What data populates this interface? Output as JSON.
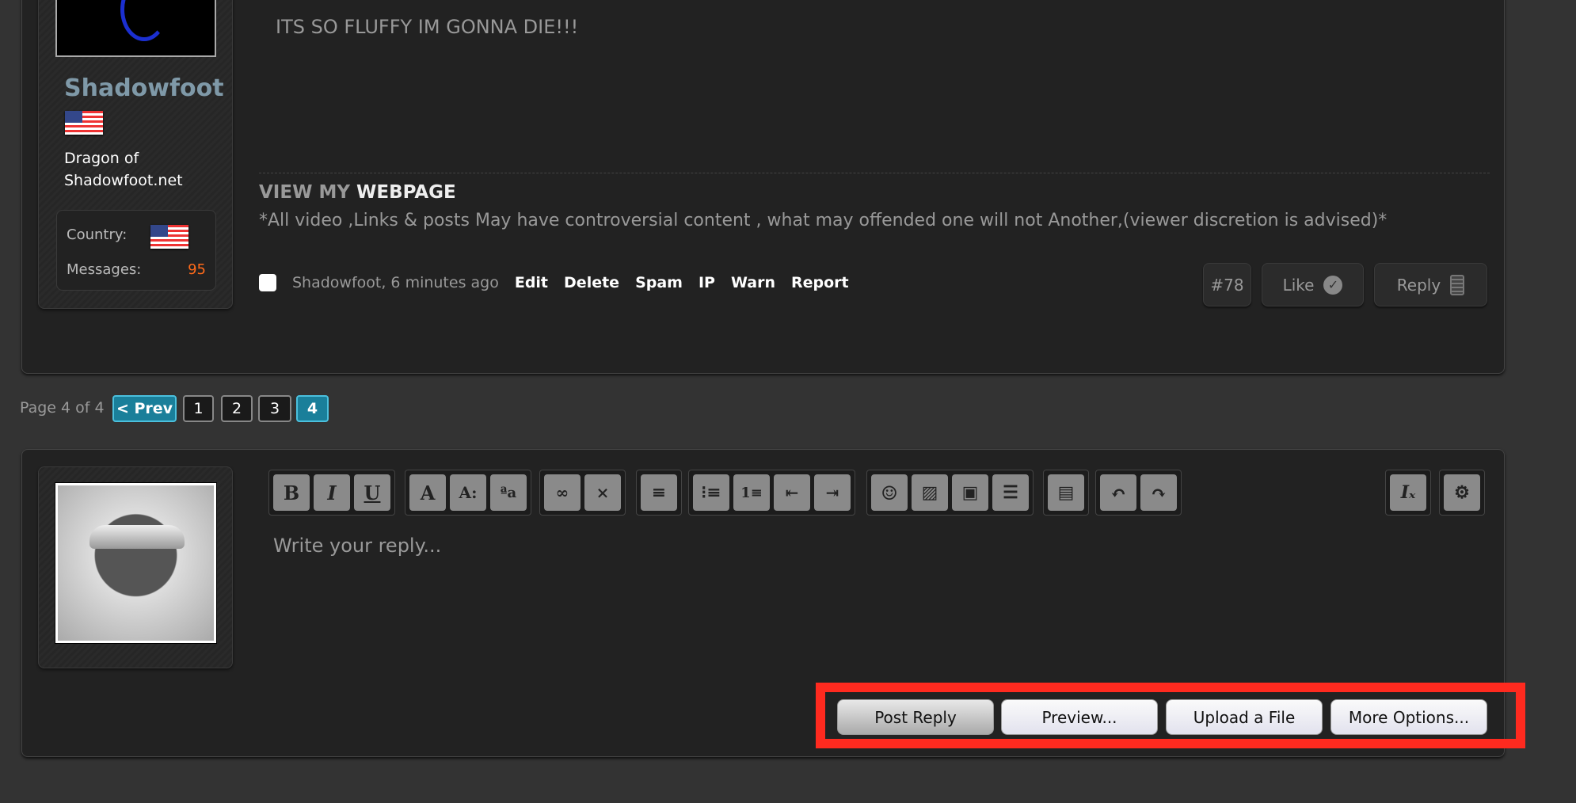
{
  "post": {
    "username": "Shadowfoot",
    "user_title": [
      "Dragon of",
      "Shadowfoot.net"
    ],
    "stats": {
      "country_label": "Country:",
      "messages_label": "Messages:",
      "messages": "95"
    },
    "message": "ITS SO FLUFFY IM GONNA DIE!!!",
    "signature": {
      "view_my": "VIEW MY",
      "webpage": "WEBPAGE",
      "disclaimer": "*All video ,Links & posts May have controversial content , what may offended one will not Another,(viewer discretion is advised)*"
    },
    "meta": "Shadowfoot, 6 minutes ago",
    "actions": [
      "Edit",
      "Delete",
      "Spam",
      "IP",
      "Warn",
      "Report"
    ],
    "number": "#78",
    "like": "Like",
    "reply": "Reply"
  },
  "pagination": {
    "label": "Page 4 of 4",
    "prev": "< Prev",
    "pages": [
      "1",
      "2",
      "3",
      "4"
    ],
    "current": "4"
  },
  "editor": {
    "placeholder": "Write your reply...",
    "toolbar": [
      "bold",
      "italic",
      "underline",
      "font-color",
      "font-size",
      "font-family",
      "link",
      "unlink",
      "align",
      "bullet-list",
      "numbered-list",
      "outdent",
      "indent",
      "smilies",
      "image",
      "media",
      "template",
      "save-draft",
      "undo",
      "redo",
      "remove-format",
      "toggle-bbcode"
    ],
    "buttons": {
      "post_reply": "Post Reply",
      "preview": "Preview...",
      "upload": "Upload a File",
      "more": "More Options..."
    }
  },
  "colors": {
    "page_bg": "#333333",
    "panel_bg": "#222222",
    "accent": "#1a7f9a",
    "username": "#7f99a8",
    "count": "#ff6a1a",
    "highlight": "#ff2a1f"
  }
}
